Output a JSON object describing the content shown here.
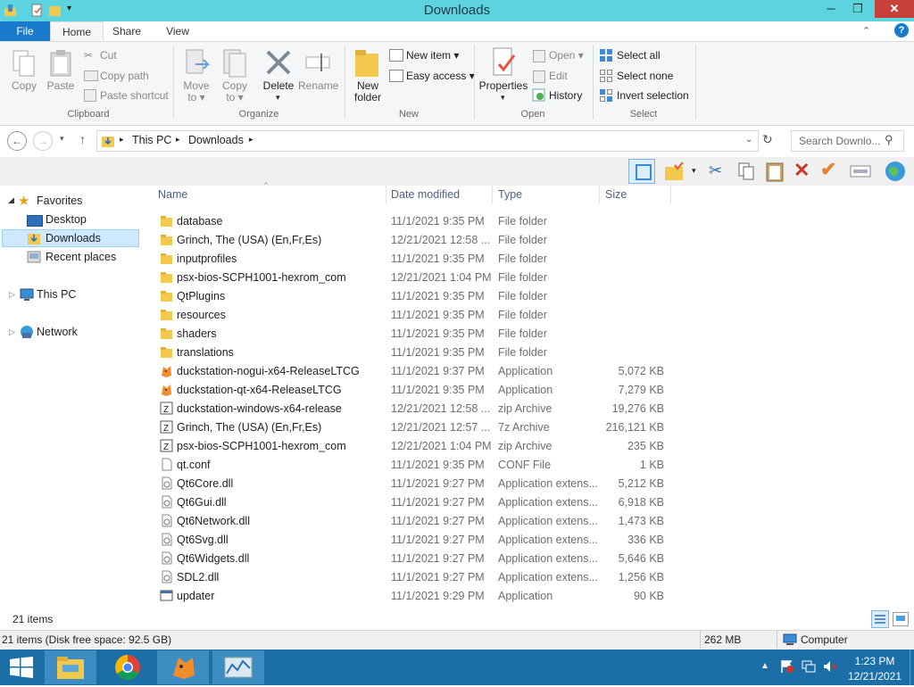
{
  "window": {
    "title": "Downloads",
    "min": "─",
    "max": "❐",
    "close": "✕"
  },
  "tabs": {
    "file": "File",
    "home": "Home",
    "share": "Share",
    "view": "View"
  },
  "ribbon": {
    "clipboard": {
      "copy": "Copy",
      "paste": "Paste",
      "cut": "Cut",
      "copy_path": "Copy path",
      "paste_shortcut": "Paste shortcut",
      "label": "Clipboard"
    },
    "organize": {
      "move_to": "Move to",
      "copy_to": "Copy to",
      "delete": "Delete",
      "rename": "Rename",
      "label": "Organize"
    },
    "new": {
      "new_folder": "New folder",
      "new_item": "New item",
      "easy_access": "Easy access",
      "label": "New"
    },
    "open": {
      "properties": "Properties",
      "open": "Open",
      "edit": "Edit",
      "history": "History",
      "label": "Open"
    },
    "select": {
      "select_all": "Select all",
      "select_none": "Select none",
      "invert": "Invert selection",
      "label": "Select"
    }
  },
  "address": {
    "crumbs": [
      "This PC",
      "Downloads"
    ],
    "search_placeholder": "Search Downlo..."
  },
  "nav": {
    "favorites": "Favorites",
    "desktop": "Desktop",
    "downloads": "Downloads",
    "recent": "Recent places",
    "this_pc": "This PC",
    "network": "Network"
  },
  "columns": {
    "name": "Name",
    "date": "Date modified",
    "type": "Type",
    "size": "Size"
  },
  "files": [
    {
      "name": "database",
      "date": "11/1/2021 9:35 PM",
      "type": "File folder",
      "size": "",
      "icon": "folder"
    },
    {
      "name": "Grinch, The (USA) (En,Fr,Es)",
      "date": "12/21/2021 12:58 ...",
      "type": "File folder",
      "size": "",
      "icon": "folder"
    },
    {
      "name": "inputprofiles",
      "date": "11/1/2021 9:35 PM",
      "type": "File folder",
      "size": "",
      "icon": "folder"
    },
    {
      "name": "psx-bios-SCPH1001-hexrom_com",
      "date": "12/21/2021 1:04 PM",
      "type": "File folder",
      "size": "",
      "icon": "folder"
    },
    {
      "name": "QtPlugins",
      "date": "11/1/2021 9:35 PM",
      "type": "File folder",
      "size": "",
      "icon": "folder"
    },
    {
      "name": "resources",
      "date": "11/1/2021 9:35 PM",
      "type": "File folder",
      "size": "",
      "icon": "folder"
    },
    {
      "name": "shaders",
      "date": "11/1/2021 9:35 PM",
      "type": "File folder",
      "size": "",
      "icon": "folder"
    },
    {
      "name": "translations",
      "date": "11/1/2021 9:35 PM",
      "type": "File folder",
      "size": "",
      "icon": "folder"
    },
    {
      "name": "duckstation-nogui-x64-ReleaseLTCG",
      "date": "11/1/2021 9:37 PM",
      "type": "Application",
      "size": "5,072 KB",
      "icon": "app"
    },
    {
      "name": "duckstation-qt-x64-ReleaseLTCG",
      "date": "11/1/2021 9:35 PM",
      "type": "Application",
      "size": "7,279 KB",
      "icon": "app"
    },
    {
      "name": "duckstation-windows-x64-release",
      "date": "12/21/2021 12:58 ...",
      "type": "zip Archive",
      "size": "19,276 KB",
      "icon": "archive"
    },
    {
      "name": "Grinch, The (USA) (En,Fr,Es)",
      "date": "12/21/2021 12:57 ...",
      "type": "7z Archive",
      "size": "216,121 KB",
      "icon": "archive"
    },
    {
      "name": "psx-bios-SCPH1001-hexrom_com",
      "date": "12/21/2021 1:04 PM",
      "type": "zip Archive",
      "size": "235 KB",
      "icon": "archive"
    },
    {
      "name": "qt.conf",
      "date": "11/1/2021 9:35 PM",
      "type": "CONF File",
      "size": "1 KB",
      "icon": "file"
    },
    {
      "name": "Qt6Core.dll",
      "date": "11/1/2021 9:27 PM",
      "type": "Application extens...",
      "size": "5,212 KB",
      "icon": "dll"
    },
    {
      "name": "Qt6Gui.dll",
      "date": "11/1/2021 9:27 PM",
      "type": "Application extens...",
      "size": "6,918 KB",
      "icon": "dll"
    },
    {
      "name": "Qt6Network.dll",
      "date": "11/1/2021 9:27 PM",
      "type": "Application extens...",
      "size": "1,473 KB",
      "icon": "dll"
    },
    {
      "name": "Qt6Svg.dll",
      "date": "11/1/2021 9:27 PM",
      "type": "Application extens...",
      "size": "336 KB",
      "icon": "dll"
    },
    {
      "name": "Qt6Widgets.dll",
      "date": "11/1/2021 9:27 PM",
      "type": "Application extens...",
      "size": "5,646 KB",
      "icon": "dll"
    },
    {
      "name": "SDL2.dll",
      "date": "11/1/2021 9:27 PM",
      "type": "Application extens...",
      "size": "1,256 KB",
      "icon": "dll"
    },
    {
      "name": "updater",
      "date": "11/1/2021 9:29 PM",
      "type": "Application",
      "size": "90 KB",
      "icon": "updater"
    }
  ],
  "status": {
    "items": "21 items",
    "disk": "21 items (Disk free space: 92.5 GB)",
    "size": "262 MB",
    "computer": "Computer"
  },
  "clock": {
    "time": "1:23 PM",
    "date": "12/21/2021"
  },
  "colors": {
    "titlebar": "#5dd3df",
    "accent": "#1979ca",
    "taskbar": "#1c6fa6",
    "folder": "#f2c94c"
  }
}
